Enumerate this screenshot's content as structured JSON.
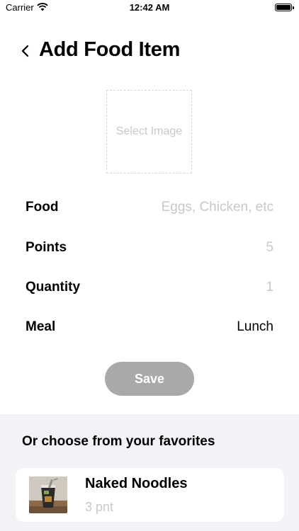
{
  "status_bar": {
    "carrier": "Carrier",
    "time": "12:42 AM"
  },
  "nav": {
    "title": "Add Food Item"
  },
  "image_picker": {
    "label": "Select Image"
  },
  "form": {
    "food": {
      "label": "Food",
      "placeholder": "Eggs, Chicken, etc",
      "value": ""
    },
    "points": {
      "label": "Points",
      "placeholder": "5",
      "value": ""
    },
    "quantity": {
      "label": "Quantity",
      "placeholder": "1",
      "value": ""
    },
    "meal": {
      "label": "Meal",
      "value": "Lunch"
    }
  },
  "save_button": {
    "label": "Save"
  },
  "favorites": {
    "heading": "Or choose from your favorites",
    "items": [
      {
        "name": "Naked Noodles",
        "points": "3 pnt"
      }
    ]
  },
  "colors": {
    "save_disabled": "#a9a9a9",
    "favorites_bg": "#f2f2f7",
    "placeholder": "#c8c8cc"
  }
}
